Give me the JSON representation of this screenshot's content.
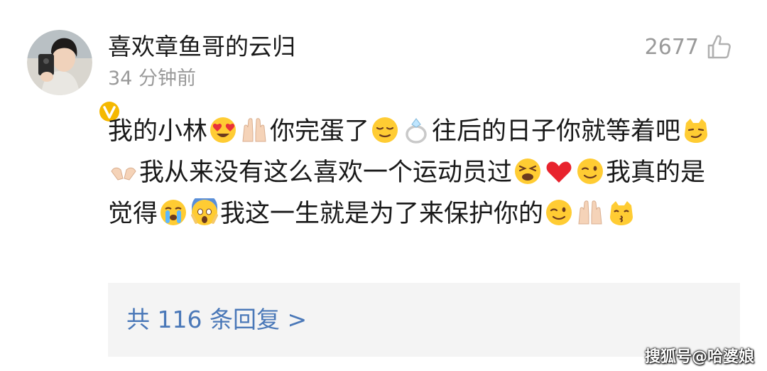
{
  "comment": {
    "author": "喜欢章鱼哥的云归",
    "time": "34 分钟前",
    "likes": "2677",
    "segments": [
      "我的小林",
      "你完蛋了",
      "往后的日子你就等着吧",
      "我从来没有这么喜欢一个运动员过",
      "我真的是觉得",
      "我这一生就是为了来保护你的"
    ],
    "emoji_names": [
      "heart-eyes-emoji",
      "raised-hands-emoji",
      "relieved-face-emoji",
      "ring-emoji",
      "smirking-cat-emoji",
      "open-hands-emoji",
      "tired-face-emoji",
      "red-heart-emoji",
      "winking-face-emoji",
      "crying-face-emoji",
      "screaming-face-emoji",
      "winking-face-emoji",
      "raised-hands-emoji",
      "kissing-cat-emoji"
    ],
    "replies_link": "共 116 条回复 >"
  },
  "watermark": "搜狐号@哈婆娘",
  "colors": {
    "text": "#1a1a1a",
    "muted": "#9a9a9a",
    "link": "#4a78b8",
    "reply_bg": "#f4f4f4",
    "verified_badge": "#f5b800"
  }
}
